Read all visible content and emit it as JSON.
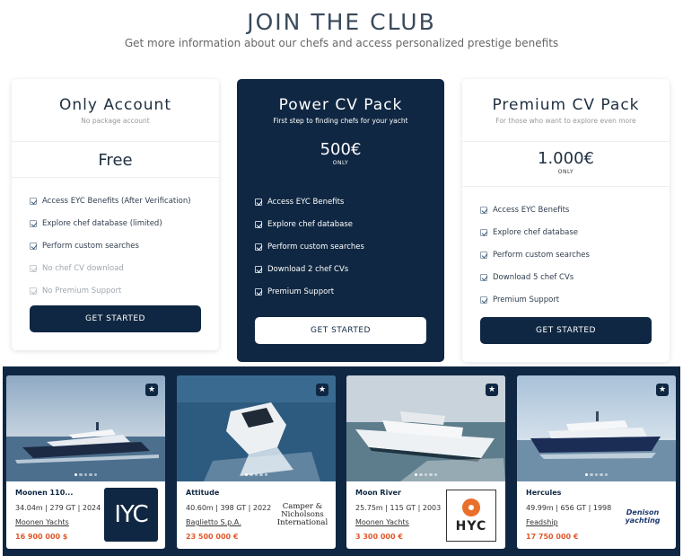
{
  "hero": {
    "title": "JOIN THE CLUB",
    "subtitle": "Get more information about our chefs and access personalized prestige benefits"
  },
  "plans": [
    {
      "name": "Only Account",
      "description": "No package account",
      "price": "Free",
      "only_label": "",
      "features": [
        {
          "label": "Access EYC Benefits (After Verification)",
          "enabled": true
        },
        {
          "label": "Explore chef database (limited)",
          "enabled": true
        },
        {
          "label": "Perform custom searches",
          "enabled": true
        },
        {
          "label": "No chef CV download",
          "enabled": false
        },
        {
          "label": "No Premium Support",
          "enabled": false
        }
      ],
      "button": "GET STARTED"
    },
    {
      "name": "Power CV Pack",
      "description": "First step to finding chefs for your yacht",
      "price": "500€",
      "only_label": "ONLY",
      "features": [
        {
          "label": "Access EYC Benefits",
          "enabled": true
        },
        {
          "label": "Explore chef database",
          "enabled": true
        },
        {
          "label": "Perform custom searches",
          "enabled": true
        },
        {
          "label": "Download 2 chef CVs",
          "enabled": true
        },
        {
          "label": "Premium Support",
          "enabled": true
        }
      ],
      "button": "GET STARTED"
    },
    {
      "name": "Premium CV Pack",
      "description": "For those who want to explore even more",
      "price": "1.000€",
      "only_label": "ONLY",
      "features": [
        {
          "label": "Access EYC Benefits",
          "enabled": true
        },
        {
          "label": "Explore chef database",
          "enabled": true
        },
        {
          "label": "Perform custom searches",
          "enabled": true
        },
        {
          "label": "Download 5 chef CVs",
          "enabled": true
        },
        {
          "label": "Premium Support",
          "enabled": true
        }
      ],
      "button": "GET STARTED"
    }
  ],
  "yachts": [
    {
      "name": "Moonen 110...",
      "specs": "34.04m  | 279 GT  | 2024",
      "builder": "Moonen Yachts",
      "price": "16 900 000 $",
      "logo_text": "IYC",
      "favorite_icon": "star-icon"
    },
    {
      "name": "Attitude",
      "specs": "40.60m  | 398 GT  | 2022",
      "builder": "Baglietto S.p.A.",
      "price": "23 500 000 €",
      "logo_text": "Camper & Nicholsons International",
      "favorite_icon": "star-icon"
    },
    {
      "name": "Moon River",
      "specs": "25.75m  | 115 GT  | 2003",
      "builder": "Moonen Yachts",
      "price": "3 300 000 €",
      "logo_text": "HYC",
      "favorite_icon": "star-icon"
    },
    {
      "name": "Hercules",
      "specs": "49.99m  | 656 GT  | 1998",
      "builder": "Feadship",
      "price": "17 750 000 €",
      "logo_text": "Denison yachting",
      "favorite_icon": "star-icon"
    }
  ],
  "colors": {
    "navy": "#0f2742",
    "price_orange": "#e0592a",
    "hyc_orange": "#e8702a"
  }
}
